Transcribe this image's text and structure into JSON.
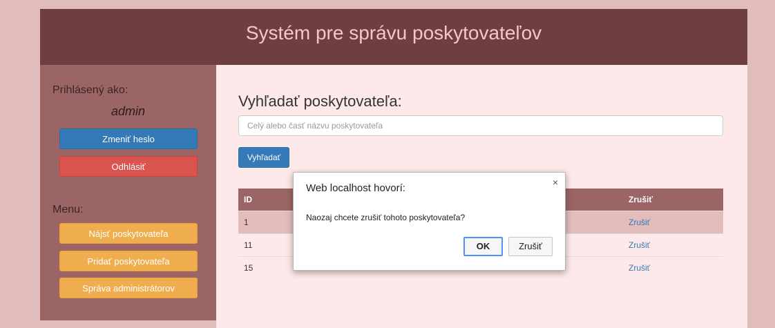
{
  "header": {
    "title": "Systém pre správu poskytovateľov"
  },
  "sidebar": {
    "logged_in_label": "Prihlásený ako:",
    "username": "admin",
    "change_password": "Zmeniť heslo",
    "logout": "Odhlásiť",
    "menu_label": "Menu:",
    "menu_items": [
      "Nájsť poskytovateľa",
      "Pridať poskytovateľa",
      "Správa administrátorov"
    ]
  },
  "main": {
    "search_title": "Vyhľadať poskytovateľa:",
    "search_placeholder": "Celý alebo časť názvu poskytovateľa",
    "search_button": "Vyhľadať",
    "table": {
      "headers": {
        "id": "ID",
        "cancel": "Zrušiť"
      },
      "rows": [
        {
          "id": "1",
          "cancel": "Zrušiť"
        },
        {
          "id": "11",
          "cancel": "Zrušiť"
        },
        {
          "id": "15",
          "cancel": "Zrušiť"
        }
      ]
    }
  },
  "dialog": {
    "title": "Web localhost hovorí:",
    "close": "×",
    "message": "Naozaj chcete zrušiť tohoto poskytovateľa?",
    "ok": "OK",
    "cancel": "Zrušiť"
  },
  "colors": {
    "header_bg": "#6f3f3f",
    "sidebar_bg": "#9c6565",
    "main_bg": "#fde9e9",
    "primary": "#337ab7",
    "danger": "#d9534f",
    "warning": "#f0ad4e"
  }
}
